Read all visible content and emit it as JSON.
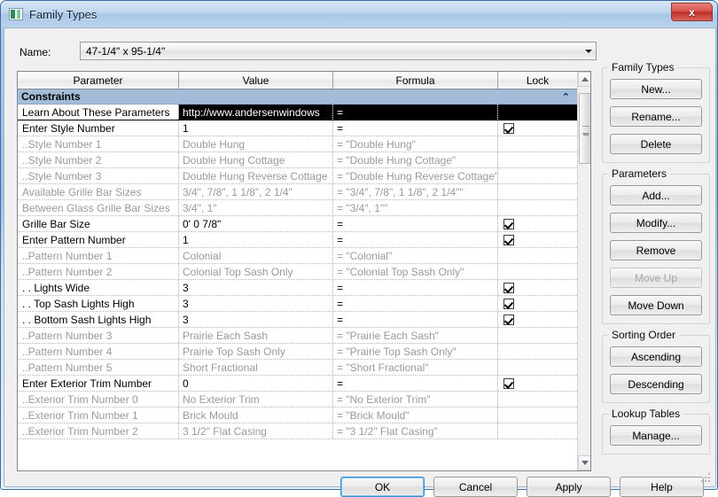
{
  "window": {
    "title": "Family Types",
    "icon": "revit-family-icon",
    "close_label": "x"
  },
  "name_field": {
    "label": "Name:",
    "value": "47-1/4\" x 95-1/4\"",
    "dropdown_icon": "chevron-down-icon"
  },
  "table": {
    "columns": [
      "Parameter",
      "Value",
      "Formula",
      "Lock"
    ],
    "group": {
      "label": "Constraints",
      "collapse_icon": "chevron-up-icon"
    },
    "rows": [
      {
        "parameter": "Learn About These Parameters",
        "value": "http://www.andersenwindows",
        "formula": "=",
        "lock": false,
        "style": "selected"
      },
      {
        "parameter": "Enter Style Number",
        "value": "1",
        "formula": "=",
        "lock": true,
        "style": "normal"
      },
      {
        "parameter": "..Style Number 1",
        "value": "Double Hung",
        "formula": "= \"Double Hung\"",
        "lock": false,
        "style": "dim"
      },
      {
        "parameter": "..Style Number 2",
        "value": "Double Hung Cottage",
        "formula": "= \"Double Hung Cottage\"",
        "lock": false,
        "style": "dim"
      },
      {
        "parameter": "..Style Number 3",
        "value": "Double Hung Reverse Cottage",
        "formula": "= \"Double Hung Reverse Cottage\"",
        "lock": false,
        "style": "dim"
      },
      {
        "parameter": "Available Grille Bar Sizes",
        "value": "3/4\", 7/8\", 1 1/8\", 2 1/4\"",
        "formula": "= \"3/4\", 7/8\", 1 1/8\", 2 1/4\"\"",
        "lock": false,
        "style": "dim"
      },
      {
        "parameter": "Between Glass Grille Bar Sizes",
        "value": "3/4\", 1\"",
        "formula": "= \"3/4\", 1\"\"",
        "lock": false,
        "style": "dim"
      },
      {
        "parameter": "Grille Bar Size",
        "value": "0'  0 7/8\"",
        "formula": "=",
        "lock": true,
        "style": "normal"
      },
      {
        "parameter": "Enter Pattern Number",
        "value": "1",
        "formula": "=",
        "lock": true,
        "style": "normal"
      },
      {
        "parameter": "..Pattern Number 1",
        "value": "Colonial",
        "formula": "= \"Colonial\"",
        "lock": false,
        "style": "dim"
      },
      {
        "parameter": "..Pattern Number 2",
        "value": "Colonial Top Sash Only",
        "formula": "= \"Colonial Top Sash Only\"",
        "lock": false,
        "style": "dim"
      },
      {
        "parameter": ". . Lights Wide",
        "value": "3",
        "formula": "=",
        "lock": true,
        "style": "normal"
      },
      {
        "parameter": ". . Top Sash Lights High",
        "value": "3",
        "formula": "=",
        "lock": true,
        "style": "normal"
      },
      {
        "parameter": ". . Bottom Sash Lights High",
        "value": "3",
        "formula": "=",
        "lock": true,
        "style": "normal"
      },
      {
        "parameter": "..Pattern Number 3",
        "value": "Prairie Each Sash",
        "formula": "= \"Prairie Each Sash\"",
        "lock": false,
        "style": "dim"
      },
      {
        "parameter": "..Pattern Number 4",
        "value": "Prairie Top Sash Only",
        "formula": "= \"Prairie Top Sash Only\"",
        "lock": false,
        "style": "dim"
      },
      {
        "parameter": "..Pattern Number 5",
        "value": "Short Fractional",
        "formula": "= \"Short Fractional\"",
        "lock": false,
        "style": "dim"
      },
      {
        "parameter": "Enter Exterior Trim Number",
        "value": "0",
        "formula": "=",
        "lock": true,
        "style": "normal"
      },
      {
        "parameter": "..Exterior Trim Number 0",
        "value": "No Exterior Trim",
        "formula": "= \"No Exterior Trim\"",
        "lock": false,
        "style": "dim"
      },
      {
        "parameter": "..Exterior Trim Number 1",
        "value": "Brick Mould",
        "formula": "= \"Brick Mould\"",
        "lock": false,
        "style": "dim"
      },
      {
        "parameter": "..Exterior Trim Number 2",
        "value": "3 1/2\" Flat Casing",
        "formula": "= \"3 1/2\" Flat Casing\"",
        "lock": false,
        "style": "dim"
      }
    ],
    "scrollbar": {
      "up_icon": "scroll-up-arrow-icon",
      "down_icon": "scroll-down-arrow-icon"
    }
  },
  "side_panel": {
    "family_types": {
      "legend": "Family Types",
      "buttons": [
        {
          "label": "New...",
          "enabled": true
        },
        {
          "label": "Rename...",
          "enabled": true
        },
        {
          "label": "Delete",
          "enabled": true
        }
      ]
    },
    "parameters": {
      "legend": "Parameters",
      "buttons": [
        {
          "label": "Add...",
          "enabled": true
        },
        {
          "label": "Modify...",
          "enabled": true
        },
        {
          "label": "Remove",
          "enabled": true
        },
        {
          "label": "Move Up",
          "enabled": false
        },
        {
          "label": "Move Down",
          "enabled": true
        }
      ]
    },
    "sorting_order": {
      "legend": "Sorting Order",
      "buttons": [
        {
          "label": "Ascending",
          "enabled": true
        },
        {
          "label": "Descending",
          "enabled": true
        }
      ]
    },
    "lookup_tables": {
      "legend": "Lookup Tables",
      "buttons": [
        {
          "label": "Manage...",
          "enabled": true
        }
      ]
    }
  },
  "footer": {
    "ok": "OK",
    "cancel": "Cancel",
    "apply": "Apply",
    "help": "Help"
  }
}
